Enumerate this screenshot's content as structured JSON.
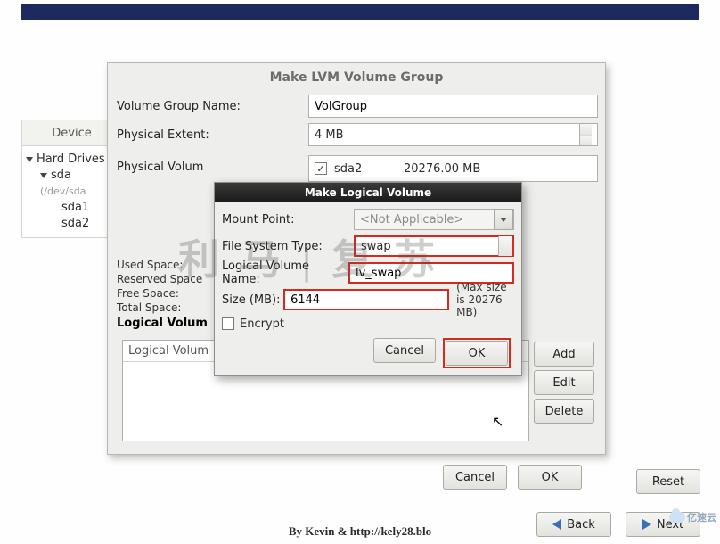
{
  "topbar": {},
  "sidebar": {
    "header": "Device",
    "root": "Hard Drives",
    "disk": "sda",
    "disk_hint": "(/dev/sda",
    "partitions": [
      "sda1",
      "sda2"
    ]
  },
  "main_dialog": {
    "title": "Make LVM Volume Group",
    "vg_name_label": "Volume Group Name:",
    "vg_name_value": "VolGroup",
    "pe_label": "Physical Extent:",
    "pe_value": "4 MB",
    "pv_label": "Physical Volum",
    "pv_checkbox_checked": true,
    "pv_name": "sda2",
    "pv_size": "20276.00 MB",
    "stats": {
      "used": "Used Space:",
      "reserved": "Reserved Space",
      "free": "Free Space:",
      "total": "Total Space:"
    },
    "lv_header": "Logical Volum",
    "lv_col": "Logical Volum",
    "buttons": {
      "add": "Add",
      "edit": "Edit",
      "delete": "Delete"
    },
    "okcancel": {
      "cancel": "Cancel",
      "ok": "OK"
    }
  },
  "inner_dialog": {
    "title": "Make Logical Volume",
    "mount_label": "Mount Point:",
    "mount_value": "<Not Applicable>",
    "fs_label": "File System Type:",
    "fs_value": "swap",
    "lvname_label": "Logical Volume Name:",
    "lvname_value": "lv_swap",
    "size_label": "Size (MB):",
    "size_value": "6144",
    "encrypt_label": "Encrypt",
    "hint": "(Max size is 20276 MB)",
    "cancel": "Cancel",
    "ok": "OK"
  },
  "reset": "Reset",
  "nav": {
    "back": "Back",
    "next": "Next"
  },
  "watermark": "利 马 | 复 苏",
  "footer": "By Kevin & http://kely28.blo",
  "corner_logo": "亿速云"
}
